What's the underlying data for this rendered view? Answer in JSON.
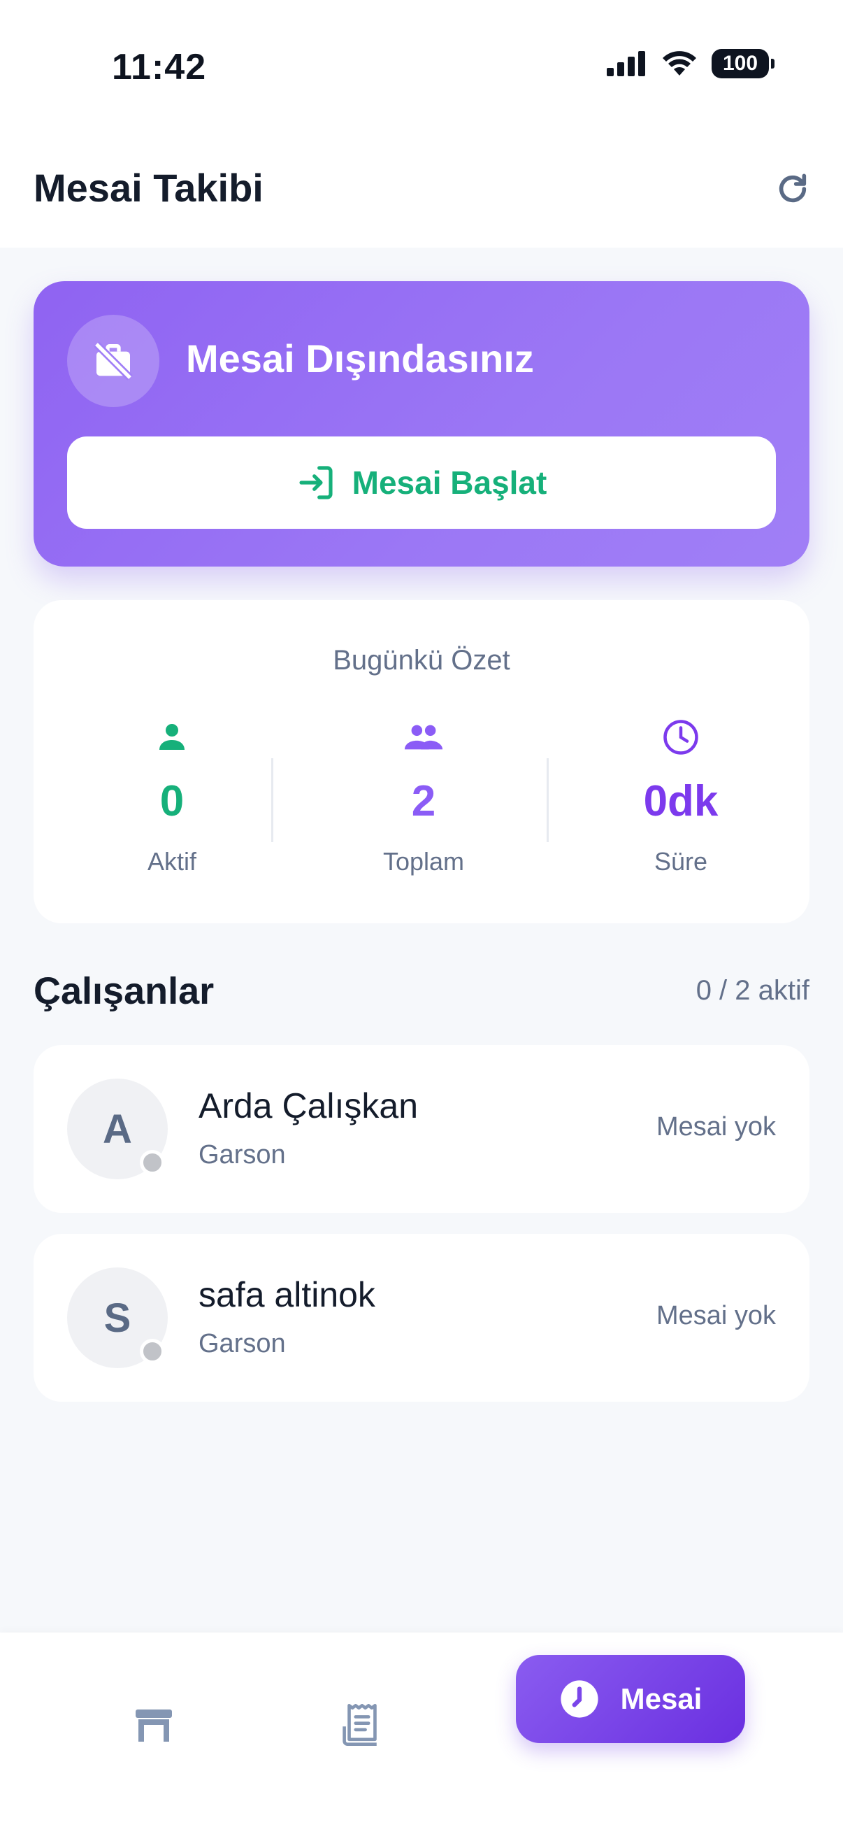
{
  "status_bar": {
    "time": "11:42",
    "battery": "100"
  },
  "header": {
    "title": "Mesai Takibi"
  },
  "shift_card": {
    "status": "Mesai Dışındasınız",
    "start_button": "Mesai Başlat"
  },
  "summary": {
    "title": "Bugünkü Özet",
    "stats": [
      {
        "value": "0",
        "label": "Aktif",
        "color": "#16b07a",
        "icon": "person-icon"
      },
      {
        "value": "2",
        "label": "Toplam",
        "color": "#8b5cf6",
        "icon": "group-icon"
      },
      {
        "value": "0dk",
        "label": "Süre",
        "color": "#7c3aed",
        "icon": "clock-icon"
      }
    ]
  },
  "employees": {
    "title": "Çalışanlar",
    "count": "0 / 2 aktif",
    "items": [
      {
        "initial": "A",
        "name": "Arda Çalışkan",
        "role": "Garson",
        "status": "Mesai yok"
      },
      {
        "initial": "S",
        "name": "safa altinok",
        "role": "Garson",
        "status": "Mesai yok"
      }
    ]
  },
  "bottom_nav": {
    "items": [
      {
        "icon": "table-icon"
      },
      {
        "icon": "receipt-icon"
      },
      {
        "icon": "clock-icon",
        "label": "Mesai",
        "active": true
      }
    ]
  },
  "colors": {
    "accent": "#8b5cf6",
    "success": "#16b07a",
    "muted": "#63708a"
  }
}
